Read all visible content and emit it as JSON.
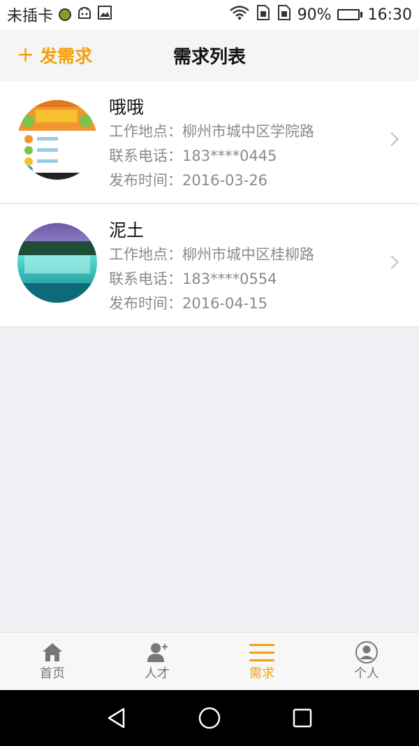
{
  "status_bar": {
    "carrier": "未插卡",
    "battery_percent": "90%",
    "battery_level": 0.9,
    "time": "16:30",
    "icons": [
      "sim-icon",
      "android-debug-icon",
      "image-icon",
      "wifi-icon",
      "sim-card-icon",
      "sim-card-icon",
      "battery-icon"
    ]
  },
  "header": {
    "post_plus": "+",
    "post_label": "发需求",
    "title": "需求列表"
  },
  "items": [
    {
      "name": "哦哦",
      "location_label": "工作地点：",
      "location": "柳州市城中区学院路",
      "phone_label": "联系电话：",
      "phone": "183****0445",
      "date_label": "发布时间：",
      "date": "2016-03-26"
    },
    {
      "name": "泥土",
      "location_label": "工作地点：",
      "location": "柳州市城中区桂柳路",
      "phone_label": "联系电话：",
      "phone": "183****0554",
      "date_label": "发布时间：",
      "date": "2016-04-15"
    }
  ],
  "tabs": [
    {
      "label": "首页",
      "icon": "home-icon",
      "active": false
    },
    {
      "label": "人才",
      "icon": "person-add-icon",
      "active": false
    },
    {
      "label": "需求",
      "icon": "menu-list-icon",
      "active": true
    },
    {
      "label": "个人",
      "icon": "profile-icon",
      "active": false
    }
  ],
  "colors": {
    "accent": "#f5a00f",
    "inactive": "#777777",
    "background": "#efeff4"
  }
}
